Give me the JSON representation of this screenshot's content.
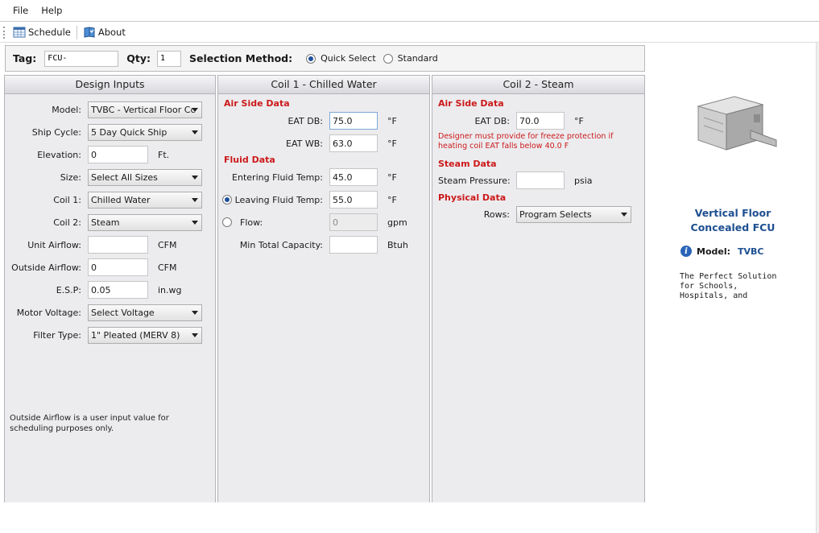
{
  "menu": [
    "File",
    "Help"
  ],
  "toolbar": {
    "schedule": "Schedule",
    "about": "About"
  },
  "tagbar": {
    "tag_label": "Tag:",
    "tag_value": "FCU-",
    "qty_label": "Qty:",
    "qty_value": "1",
    "method_label": "Selection Method:",
    "quick_select": "Quick Select",
    "standard": "Standard"
  },
  "design": {
    "title": "Design Inputs",
    "model_label": "Model:",
    "model_value": "TVBC - Vertical Floor Cc",
    "ship_label": "Ship Cycle:",
    "ship_value": "5 Day Quick Ship",
    "elev_label": "Elevation:",
    "elev_value": "0",
    "elev_unit": "Ft.",
    "size_label": "Size:",
    "size_value": "Select All Sizes",
    "coil1_label": "Coil 1:",
    "coil1_value": "Chilled Water",
    "coil2_label": "Coil 2:",
    "coil2_value": "Steam",
    "unit_airflow_label": "Unit Airflow:",
    "unit_airflow_value": "",
    "unit_airflow_unit": "CFM",
    "outside_airflow_label": "Outside Airflow:",
    "outside_airflow_value": "0",
    "outside_airflow_unit": "CFM",
    "esp_label": "E.S.P:",
    "esp_value": "0.05",
    "esp_unit": "in.wg",
    "voltage_label": "Motor Voltage:",
    "voltage_value": "Select Voltage",
    "filter_label": "Filter Type:",
    "filter_value": "1\" Pleated (MERV 8)",
    "note": "Outside Airflow is a user input value for scheduling purposes only."
  },
  "coil1": {
    "title": "Coil 1 - Chilled Water",
    "air_side": "Air Side Data",
    "eat_db_label": "EAT DB:",
    "eat_db_value": "75.0",
    "eat_db_unit": "°F",
    "eat_wb_label": "EAT WB:",
    "eat_wb_value": "63.0",
    "eat_wb_unit": "°F",
    "fluid": "Fluid Data",
    "entering_label": "Entering Fluid Temp:",
    "entering_value": "45.0",
    "entering_unit": "°F",
    "leaving_label": "Leaving Fluid Temp:",
    "leaving_value": "55.0",
    "leaving_unit": "°F",
    "flow_label": "Flow:",
    "flow_value": "0",
    "flow_unit": "gpm",
    "min_cap_label": "Min Total Capacity:",
    "min_cap_value": "",
    "min_cap_unit": "Btuh"
  },
  "coil2": {
    "title": "Coil 2 - Steam",
    "air_side": "Air Side Data",
    "eat_db_label": "EAT DB:",
    "eat_db_value": "70.0",
    "eat_db_unit": "°F",
    "warning": "Designer must provide for freeze protection if heating coil EAT falls below 40.0 F",
    "steam": "Steam Data",
    "pressure_label": "Steam Pressure:",
    "pressure_value": "",
    "pressure_unit": "psia",
    "physical": "Physical Data",
    "rows_label": "Rows:",
    "rows_value": "Program Selects"
  },
  "side": {
    "title_line1": "Vertical Floor",
    "title_line2": "Concealed FCU",
    "model_label": "Model:",
    "model_value": "TVBC",
    "desc": "The Perfect Solution\nfor Schools,\nHospitals, and"
  },
  "colors": {
    "section_red": "#cc1a1a",
    "model_blue": "#1e4f91"
  }
}
